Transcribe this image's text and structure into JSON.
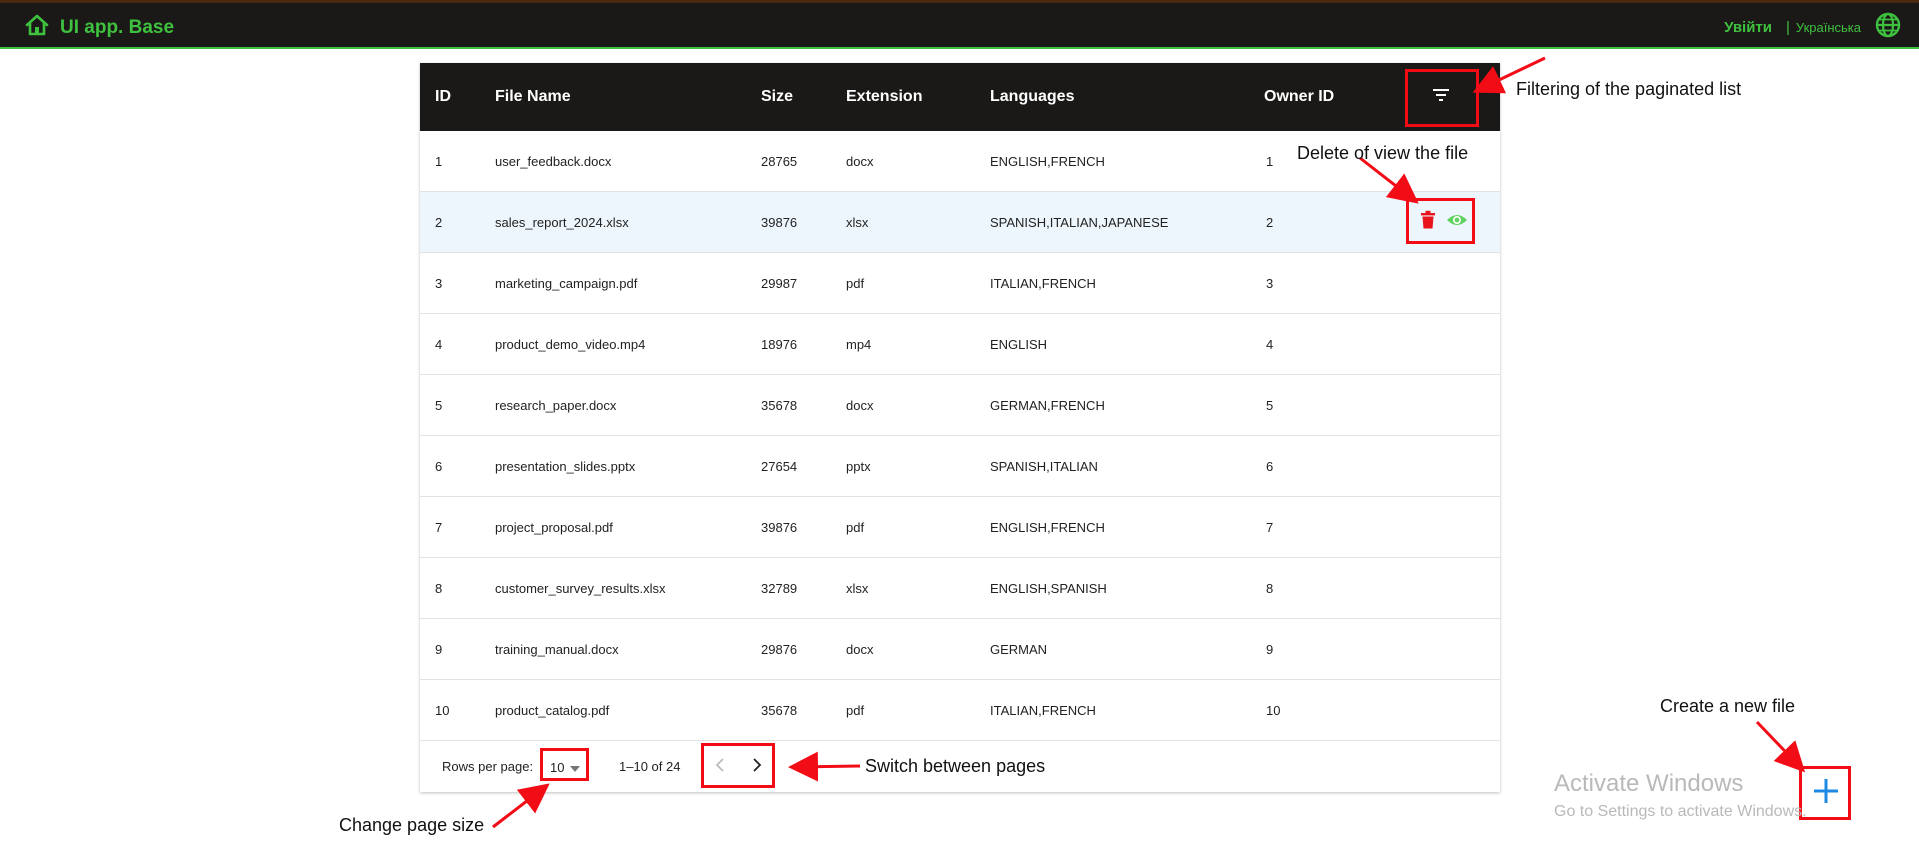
{
  "app": {
    "title": "UI app. Base",
    "login_label": "Увійти",
    "separator": "|",
    "language_label": "Українська",
    "icons": {
      "home": "home-icon",
      "globe": "globe-icon"
    },
    "accent_color": "#3ec13e",
    "header_bg": "#1b1917"
  },
  "table": {
    "columns": [
      "ID",
      "File Name",
      "Size",
      "Extension",
      "Languages",
      "Owner ID"
    ],
    "rows": [
      {
        "id": "1",
        "name": "user_feedback.docx",
        "size": "28765",
        "ext": "docx",
        "langs": "ENGLISH,FRENCH",
        "owner": "1"
      },
      {
        "id": "2",
        "name": "sales_report_2024.xlsx",
        "size": "39876",
        "ext": "xlsx",
        "langs": "SPANISH,ITALIAN,JAPANESE",
        "owner": "2"
      },
      {
        "id": "3",
        "name": "marketing_campaign.pdf",
        "size": "29987",
        "ext": "pdf",
        "langs": "ITALIAN,FRENCH",
        "owner": "3"
      },
      {
        "id": "4",
        "name": "product_demo_video.mp4",
        "size": "18976",
        "ext": "mp4",
        "langs": "ENGLISH",
        "owner": "4"
      },
      {
        "id": "5",
        "name": "research_paper.docx",
        "size": "35678",
        "ext": "docx",
        "langs": "GERMAN,FRENCH",
        "owner": "5"
      },
      {
        "id": "6",
        "name": "presentation_slides.pptx",
        "size": "27654",
        "ext": "pptx",
        "langs": "SPANISH,ITALIAN",
        "owner": "6"
      },
      {
        "id": "7",
        "name": "project_proposal.pdf",
        "size": "39876",
        "ext": "pdf",
        "langs": "ENGLISH,FRENCH",
        "owner": "7"
      },
      {
        "id": "8",
        "name": "customer_survey_results.xlsx",
        "size": "32789",
        "ext": "xlsx",
        "langs": "ENGLISH,SPANISH",
        "owner": "8"
      },
      {
        "id": "9",
        "name": "training_manual.docx",
        "size": "29876",
        "ext": "docx",
        "langs": "GERMAN",
        "owner": "9"
      },
      {
        "id": "10",
        "name": "product_catalog.pdf",
        "size": "35678",
        "ext": "pdf",
        "langs": "ITALIAN,FRENCH",
        "owner": "10"
      }
    ],
    "highlighted_row": 2,
    "row_actions": {
      "delete_icon": "trash-icon",
      "view_icon": "eye-icon",
      "delete_color": "#e8131b",
      "view_color": "#5fd35f"
    }
  },
  "pagination": {
    "rows_per_page_label": "Rows per page:",
    "rows_per_page": "10",
    "range_text": "1–10 of 24"
  },
  "annotations": {
    "filter": "Filtering of the paginated list",
    "row_actions": "Delete of view the file",
    "switch_pages": "Switch between pages",
    "page_size": "Change page size",
    "create": "Create a new file",
    "color": "#f20c16"
  },
  "watermark": {
    "line1": "Activate Windows",
    "line2": "Go to Settings to activate Windows."
  }
}
